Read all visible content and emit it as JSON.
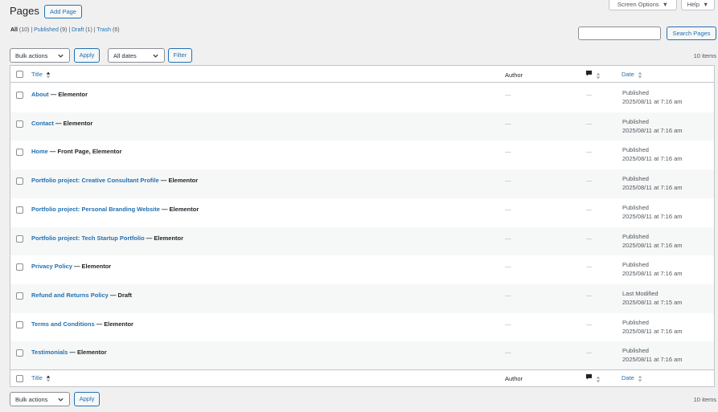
{
  "header": {
    "title": "Pages",
    "add_new_label": "Add Page",
    "screen_options_label": "Screen Options",
    "help_label": "Help"
  },
  "subsubsub": {
    "all_label": "All",
    "all_count": "(10)",
    "published_label": "Published",
    "published_count": "(9)",
    "draft_label": "Draft",
    "draft_count": "(1)",
    "trash_label": "Trash",
    "trash_count": "(6)",
    "separator": "|"
  },
  "search": {
    "value": "",
    "button_label": "Search Pages"
  },
  "tablenav_top": {
    "bulk_actions": "Bulk actions",
    "apply_label": "Apply",
    "dates_filter": "All dates",
    "filter_label": "Filter",
    "items_count": "10 items"
  },
  "columns": {
    "title": "Title",
    "author": "Author",
    "date": "Date"
  },
  "rows": [
    {
      "title": "About",
      "suffix": " — Elementor",
      "author": "—",
      "comments": "—",
      "status": "Published",
      "date": "2025/08/11 at 7:16 am"
    },
    {
      "title": "Contact",
      "suffix": " — Elementor",
      "author": "—",
      "comments": "—",
      "status": "Published",
      "date": "2025/08/11 at 7:16 am"
    },
    {
      "title": "Home",
      "suffix": " — Front Page, Elementor",
      "author": "—",
      "comments": "—",
      "status": "Published",
      "date": "2025/08/11 at 7:16 am"
    },
    {
      "title": "Portfolio project: Creative Consultant Profile",
      "suffix": " — Elementor",
      "author": "—",
      "comments": "—",
      "status": "Published",
      "date": "2025/08/11 at 7:16 am"
    },
    {
      "title": "Portfolio project: Personal Branding Website",
      "suffix": " — Elementor",
      "author": "—",
      "comments": "—",
      "status": "Published",
      "date": "2025/08/11 at 7:16 am"
    },
    {
      "title": "Portfolio project: Tech Startup Portfolio",
      "suffix": " — Elementor",
      "author": "—",
      "comments": "—",
      "status": "Published",
      "date": "2025/08/11 at 7:16 am"
    },
    {
      "title": "Privacy Policy",
      "suffix": " — Elementor",
      "author": "—",
      "comments": "—",
      "status": "Published",
      "date": "2025/08/11 at 7:16 am"
    },
    {
      "title": "Refund and Returns Policy",
      "suffix": " — Draft",
      "author": "—",
      "comments": "—",
      "status": "Last Modified",
      "date": "2025/08/11 at 7:15 am"
    },
    {
      "title": "Terms and Conditions",
      "suffix": " — Elementor",
      "author": "—",
      "comments": "—",
      "status": "Published",
      "date": "2025/08/11 at 7:16 am"
    },
    {
      "title": "Testimonials",
      "suffix": " — Elementor",
      "author": "—",
      "comments": "—",
      "status": "Published",
      "date": "2025/08/11 at 7:16 am"
    }
  ],
  "tablenav_bottom": {
    "bulk_actions": "Bulk actions",
    "apply_label": "Apply",
    "items_count": "10 items"
  },
  "icons": {
    "sort": "sort-arrows-icon",
    "comment": "comment-bubble-icon",
    "dropdown": "chevron-down-icon"
  }
}
